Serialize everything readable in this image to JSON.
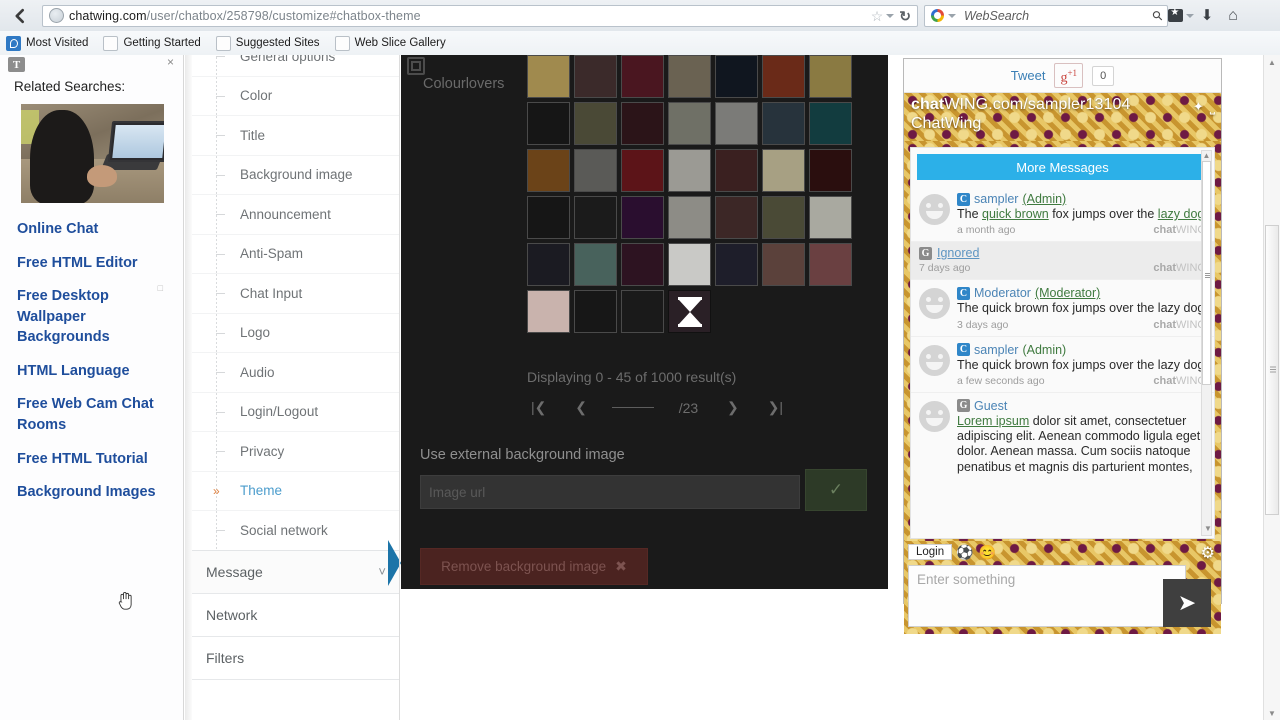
{
  "browser": {
    "url_domain": "chatwing.com",
    "url_path": "/user/chatbox/258798/customize#chatbox-theme",
    "search_placeholder": "WebSearch",
    "back_icon": "back-arrow-icon",
    "reload_icon": "reload-icon",
    "bookmarks": [
      {
        "label": "Most Visited",
        "favicon": "blue-globe-icon"
      },
      {
        "label": "Getting Started",
        "favicon": "blank-page-icon"
      },
      {
        "label": "Suggested Sites",
        "favicon": "blank-page-icon"
      },
      {
        "label": "Web Slice Gallery",
        "favicon": "blank-page-icon"
      }
    ]
  },
  "related_panel": {
    "badge": "T",
    "close_label": "×",
    "title": "Related Searches:",
    "image_alt": "woman-using-laptop-photo",
    "links": [
      "Online Chat",
      "Free HTML Editor",
      "Free Desktop Wallpaper Backgrounds",
      "HTML Language",
      "Free Web Cam Chat Rooms",
      "Free HTML Tutorial",
      "Background Images"
    ]
  },
  "settings_nav": {
    "sub_items": [
      {
        "label": "General options",
        "active": false
      },
      {
        "label": "Color",
        "active": false
      },
      {
        "label": "Title",
        "active": false
      },
      {
        "label": "Background image",
        "active": false
      },
      {
        "label": "Announcement",
        "active": false
      },
      {
        "label": "Anti-Spam",
        "active": false
      },
      {
        "label": "Chat Input",
        "active": false
      },
      {
        "label": "Logo",
        "active": false
      },
      {
        "label": "Audio",
        "active": false
      },
      {
        "label": "Login/Logout",
        "active": false
      },
      {
        "label": "Privacy",
        "active": false
      },
      {
        "label": "Theme",
        "active": true
      },
      {
        "label": "Social network",
        "active": false
      }
    ],
    "groups": [
      {
        "label": "Message",
        "has_chevron": true
      },
      {
        "label": "Network",
        "has_chevron": false
      },
      {
        "label": "Filters",
        "has_chevron": false
      }
    ]
  },
  "main": {
    "source_label": "Colourlovers",
    "results_text": "Displaying 0 - 45 of 1000 result(s)",
    "pager": {
      "first": "|❮",
      "prev": "❮",
      "page_value": "",
      "page_total": "/23",
      "next": "❯",
      "last": "❯|"
    },
    "external_label": "Use external background image",
    "external_placeholder": "Image url",
    "external_ok_icon": "checkmark-icon",
    "remove_button": "Remove background image",
    "remove_icon": "✖",
    "loading_icon": "hourglass-icon",
    "thumbnails": [
      "#a08a4e",
      "#3b2a2a",
      "#4a1620",
      "#6a6252",
      "#10161f",
      "#6a2a18",
      "#8a7a42",
      "#161616",
      "#4a4936",
      "#2b1418",
      "#6f7066",
      "#7b7b78",
      "#27333c",
      "#123c3f",
      "#6b4318",
      "#5a5a57",
      "#5c1418",
      "#9b9a94",
      "#3a2020",
      "#a7a083",
      "#2a0e0e",
      "#161616",
      "#1b1b1b",
      "#2a0e2f",
      "#8d8c86",
      "#3c2726",
      "#4a4a36",
      "#a9a9a0",
      "#1b1b22",
      "#48625c",
      "#2d1321",
      "#c9c9c6",
      "#1e1e2a",
      "#5b413b",
      "#6a4041",
      "#c9b3ad",
      "#171717",
      "#1a1a1a"
    ]
  },
  "chat": {
    "social": {
      "tweet": "Tweet",
      "gplus": "g",
      "gplus_sup": "+1",
      "count": "0"
    },
    "header": {
      "title_strong": "chat",
      "title_rest": "WING.com/sampler13104",
      "subtitle": "ChatWing",
      "icons": [
        "pin-icon",
        "expand-icon"
      ]
    },
    "more_messages": "More Messages",
    "messages": [
      {
        "type": "normal",
        "chip": "C",
        "chip_kind": "c",
        "name": "sampler",
        "role": "(Admin)",
        "role_underlined": true,
        "text_pre": "The ",
        "text_link1": "quick brown",
        "text_mid": " fox jumps over the ",
        "text_link2": "lazy dog",
        "text_post": "",
        "time": "a month ago",
        "brand_b": "chat",
        "brand_rest": "WING"
      },
      {
        "type": "ignored",
        "chip": "G",
        "chip_kind": "g",
        "name": "Ignored",
        "time": "7 days ago",
        "brand_b": "chat",
        "brand_rest": "WING"
      },
      {
        "type": "normal",
        "chip": "C",
        "chip_kind": "c",
        "name": "Moderator",
        "role": "(Moderator)",
        "role_underlined": true,
        "text_pre": "The quick brown fox jumps over the lazy dog",
        "text_link1": "",
        "text_mid": "",
        "text_link2": "",
        "text_post": "",
        "time": "3 days ago",
        "brand_b": "chat",
        "brand_rest": "WING"
      },
      {
        "type": "normal",
        "chip": "C",
        "chip_kind": "c",
        "name": "sampler",
        "role": "(Admin)",
        "role_underlined": false,
        "text_pre": "The quick brown fox jumps over the lazy dog",
        "text_link1": "",
        "text_mid": "",
        "text_link2": "",
        "text_post": "",
        "time": "a few seconds ago",
        "brand_b": "chat",
        "brand_rest": "WING"
      },
      {
        "type": "normal",
        "chip": "G",
        "chip_kind": "g",
        "name": "Guest",
        "role": "",
        "role_underlined": false,
        "text_pre": "",
        "text_link1": "Lorem ipsum",
        "text_mid": " dolor sit amet, consectetuer adipiscing elit. Aenean commodo ligula eget dolor. Aenean massa. Cum sociis natoque penatibus et magnis dis parturient montes,",
        "text_link2": "",
        "text_post": "",
        "time": "",
        "brand_b": "",
        "brand_rest": ""
      }
    ],
    "footer": {
      "login_label": "Login",
      "emoji": [
        "⚽",
        "😊"
      ],
      "gear_icon": "gear-icon",
      "input_placeholder": "Enter something",
      "send_icon": "send-arrow-icon"
    }
  },
  "colors": {
    "accent_blue": "#2cb0e8",
    "brand_gold": "#d9ac3f",
    "brand_purple": "#6e1a44",
    "link_blue": "#1f4e9c",
    "nav_active": "#4b9ccc"
  }
}
